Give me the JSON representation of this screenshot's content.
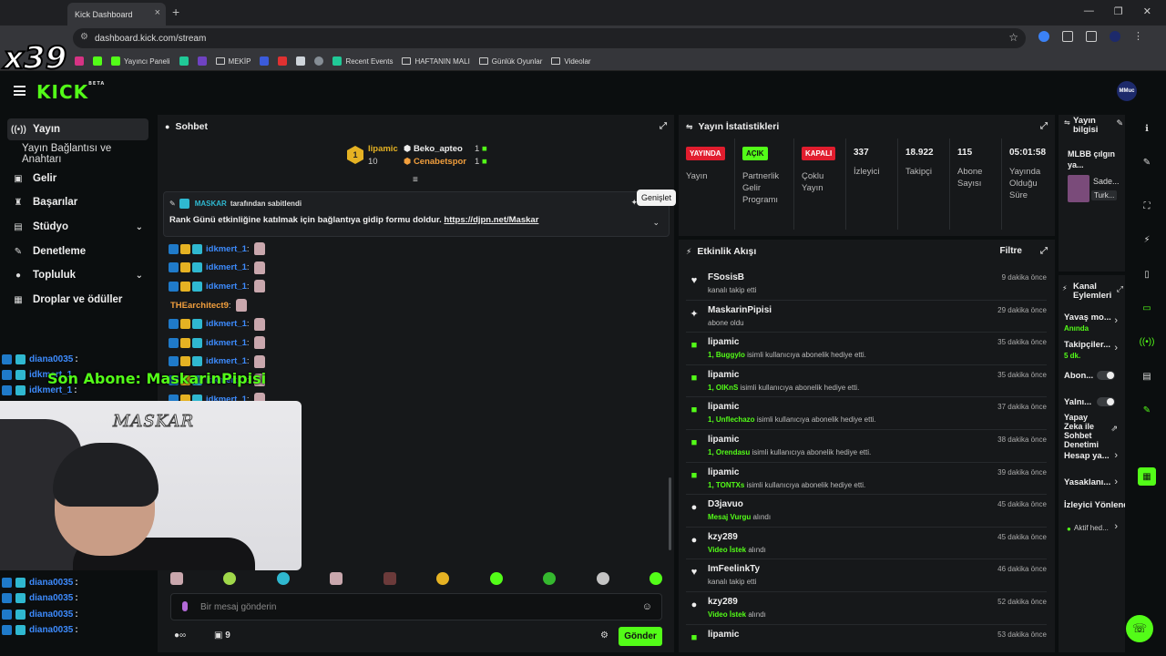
{
  "browser": {
    "tab_title": "Kick Dashboard",
    "url": "dashboard.kick.com/stream",
    "bookmarks": [
      "Yayıncı Paneli",
      "MEKİP",
      "Recent Events",
      "HAFTANIN MALI",
      "Günlük Oyunlar",
      "Videolar"
    ]
  },
  "brand": {
    "logo": "KICK",
    "beta": "BETA",
    "accent": "#53fc18",
    "avatar_text": "MMuc"
  },
  "sidebar": {
    "items": [
      {
        "label": "Yayın",
        "icon": "broadcast-icon"
      },
      {
        "label": "Yayın Bağlantısı ve Anahtarı",
        "icon": ""
      },
      {
        "label": "Gelir",
        "icon": "money-icon"
      },
      {
        "label": "Başarılar",
        "icon": "trophy-icon"
      },
      {
        "label": "Stüdyo",
        "icon": "studio-icon"
      },
      {
        "label": "Denetleme",
        "icon": "wrench-icon"
      },
      {
        "label": "Topluluk",
        "icon": "people-icon"
      },
      {
        "label": "Droplar ve ödüller",
        "icon": "gift-icon"
      }
    ]
  },
  "chat": {
    "title": "Sohbet",
    "top_gifters": {
      "first": {
        "rank": "1",
        "name": "lipamic",
        "count": "10"
      },
      "second": {
        "name": "Beko_apteo",
        "count": "1"
      },
      "third": {
        "name": "Cenabetspor",
        "count": "1"
      }
    },
    "pinned": {
      "by_user": "MASKAR",
      "by_text": "tarafından sabitlendi",
      "message": "Rank Günü etkinliğine katılmak için bağlantıya gidip formu doldur.",
      "link": "https://djpn.net/Maskar",
      "tooltip": "Genişlet"
    },
    "messages": [
      {
        "user": "idkmert_1",
        "color": "#3d8bfd"
      },
      {
        "user": "idkmert_1",
        "color": "#3d8bfd"
      },
      {
        "user": "idkmert_1",
        "color": "#3d8bfd"
      },
      {
        "user": "THEarchitect9",
        "color": "#f29f3d"
      },
      {
        "user": "idkmert_1",
        "color": "#3d8bfd"
      },
      {
        "user": "idkmert_1",
        "color": "#3d8bfd"
      },
      {
        "user": "idkmert_1",
        "color": "#3d8bfd"
      },
      {
        "user": "idkmert_1",
        "color": "#3d8bfd"
      },
      {
        "user": "idkmert_1",
        "color": "#3d8bfd"
      }
    ],
    "input_placeholder": "Bir mesaj gönderin",
    "points": "9",
    "send_label": "Gönder"
  },
  "stats": {
    "title": "Yayın İstatistikleri",
    "toggles": [
      {
        "pill": "YAYINDA",
        "label": "Yayın",
        "color": "#e11d2e"
      },
      {
        "pill": "AÇIK",
        "label": "Partnerlik Gelir Programı",
        "color": "#53fc18"
      },
      {
        "pill": "KAPALI",
        "label": "Çoklu Yayın",
        "color": "#e11d2e"
      }
    ],
    "numbers": [
      {
        "value": "337",
        "label": "İzleyici"
      },
      {
        "value": "18.922",
        "label": "Takipçi"
      },
      {
        "value": "115",
        "label": "Abone Sayısı"
      },
      {
        "value": "05:01:58",
        "label": "Yayında Olduğu Süre"
      }
    ]
  },
  "events": {
    "title": "Etkinlik Akışı",
    "filter": "Filtre",
    "items": [
      {
        "icon": "heart-icon",
        "glyph": "♥",
        "name": "FSosisB",
        "desc": "kanalı takip etti",
        "hl": "",
        "time": "9 dakika önce"
      },
      {
        "icon": "sparkle-icon",
        "glyph": "✦",
        "name": "MaskarinPipisi",
        "desc": "abone oldu",
        "hl": "",
        "time": "29 dakika önce"
      },
      {
        "icon": "gift-icon",
        "glyph": "■",
        "name": "lipamic",
        "hl": "1, Buggylo",
        "desc": "isimli kullanıcıya abonelik hediye etti.",
        "time": "35 dakika önce"
      },
      {
        "icon": "gift-icon",
        "glyph": "■",
        "name": "lipamic",
        "hl": "1, OIKnS",
        "desc": "isimli kullanıcıya abonelik hediye etti.",
        "time": "35 dakika önce"
      },
      {
        "icon": "gift-icon",
        "glyph": "■",
        "name": "lipamic",
        "hl": "1, Unflechazo",
        "desc": "isimli kullanıcıya abonelik hediye etti.",
        "time": "37 dakika önce"
      },
      {
        "icon": "gift-icon",
        "glyph": "■",
        "name": "lipamic",
        "hl": "1, Orendasu",
        "desc": "isimli kullanıcıya abonelik hediye etti.",
        "time": "38 dakika önce"
      },
      {
        "icon": "gift-icon",
        "glyph": "■",
        "name": "lipamic",
        "hl": "1, TONTXs",
        "desc": "isimli kullanıcıya abonelik hediye etti.",
        "time": "39 dakika önce"
      },
      {
        "icon": "points-icon",
        "glyph": "●",
        "name": "D3javuo",
        "hl": "Mesaj Vurgu",
        "desc": "alındı",
        "time": "45 dakika önce"
      },
      {
        "icon": "points-icon",
        "glyph": "●",
        "name": "kzy289",
        "hl": "Video İstek",
        "desc": "alındı",
        "time": "45 dakika önce"
      },
      {
        "icon": "heart-icon",
        "glyph": "♥",
        "name": "ImFeelinkTy",
        "desc": "kanalı takip etti",
        "hl": "",
        "time": "46 dakika önce"
      },
      {
        "icon": "points-icon",
        "glyph": "●",
        "name": "kzy289",
        "hl": "Video İstek",
        "desc": "alındı",
        "time": "52 dakika önce"
      },
      {
        "icon": "gift-icon",
        "glyph": "■",
        "name": "lipamic",
        "hl": "",
        "desc": "",
        "time": "53 dakika önce"
      }
    ]
  },
  "stream_info": {
    "title": "Yayın bilgisi",
    "game_title": "MLBB çılgın ya...",
    "category": "Sade...",
    "language": "Turk..."
  },
  "channel_actions": {
    "title": "Kanal Eylemleri",
    "slow_mode": "Yavaş mo...",
    "slow_mode_value": "Anında",
    "followers": "Takipçiler...",
    "followers_value": "5 dk.",
    "subs": "Abon...",
    "links": "Yalnı...",
    "ai_mod": "Yapay Zeka ile Sohbet Denetimi",
    "account": "Hesap ya...",
    "bans": "Yasaklanı...",
    "viewer_mgmt": "İzleyici Yönlendir...",
    "active": "Aktif hed..."
  },
  "overlay": {
    "counter": "x39",
    "latest_sub": "Son Abone: MaskarinPipisi",
    "watermark": "MASKAR",
    "top_chat": [
      {
        "user": "diana0035"
      },
      {
        "user": "idkmert_1"
      },
      {
        "user": "idkmert_1"
      }
    ],
    "bottom_chat": [
      {
        "user": "diana0035"
      },
      {
        "user": "diana0035"
      },
      {
        "user": "diana0035"
      },
      {
        "user": "diana0035"
      }
    ]
  }
}
